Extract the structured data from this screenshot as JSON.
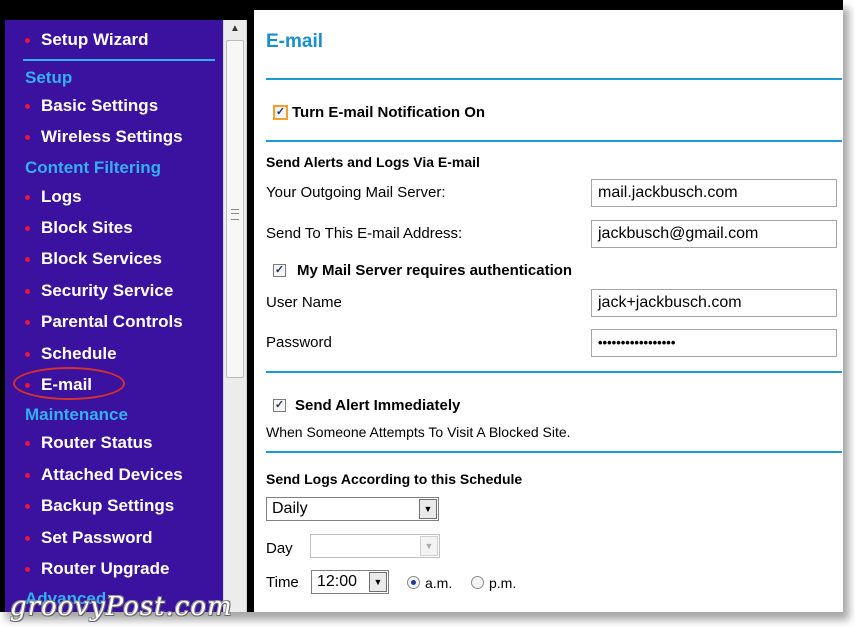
{
  "sidebar": {
    "items": [
      {
        "label": "Setup Wizard"
      },
      {
        "heading": "Setup"
      },
      {
        "label": "Basic Settings"
      },
      {
        "label": "Wireless Settings"
      },
      {
        "heading": "Content Filtering"
      },
      {
        "label": "Logs"
      },
      {
        "label": "Block Sites"
      },
      {
        "label": "Block Services"
      },
      {
        "label": "Security Service"
      },
      {
        "label": "Parental Controls"
      },
      {
        "label": "Schedule"
      },
      {
        "label": "E-mail"
      },
      {
        "heading": "Maintenance"
      },
      {
        "label": "Router Status"
      },
      {
        "label": "Attached Devices"
      },
      {
        "label": "Backup Settings"
      },
      {
        "label": "Set Password"
      },
      {
        "label": "Router Upgrade"
      },
      {
        "heading": "Advanced"
      }
    ],
    "selected": "E-mail"
  },
  "watermark": "groovyPost.com",
  "page": {
    "title": "E-mail",
    "turn_on_label": "Turn E-mail Notification On",
    "turn_on_checked": true,
    "alerts_heading": "Send Alerts and Logs Via E-mail",
    "outgoing_server_label": "Your Outgoing Mail Server:",
    "outgoing_server_value": "mail.jackbusch.com",
    "send_to_label": "Send To This E-mail Address:",
    "send_to_value": "jackbusch@gmail.com",
    "auth_label": "My Mail Server requires authentication",
    "auth_checked": true,
    "username_label": "User Name",
    "username_value": "jack+jackbusch.com",
    "password_label": "Password",
    "password_value": "•••••••••••••••••",
    "alert_immediately_label": "Send Alert Immediately",
    "alert_immediately_checked": true,
    "alert_description": "When Someone Attempts To Visit A Blocked Site.",
    "schedule_heading": "Send Logs According to this Schedule",
    "schedule_value": "Daily",
    "day_label": "Day",
    "day_value": "",
    "time_label": "Time",
    "time_value": "12:00",
    "am_label": "a.m.",
    "pm_label": "p.m.",
    "am_selected": true
  },
  "colors": {
    "sidebar_bg": "#3a129f",
    "sidebar_heading": "#33b0ee",
    "bullet": "#e8163a",
    "title": "#1a8fd0",
    "divider": "#1a9bd7",
    "highlight_circle": "#d8312c"
  }
}
